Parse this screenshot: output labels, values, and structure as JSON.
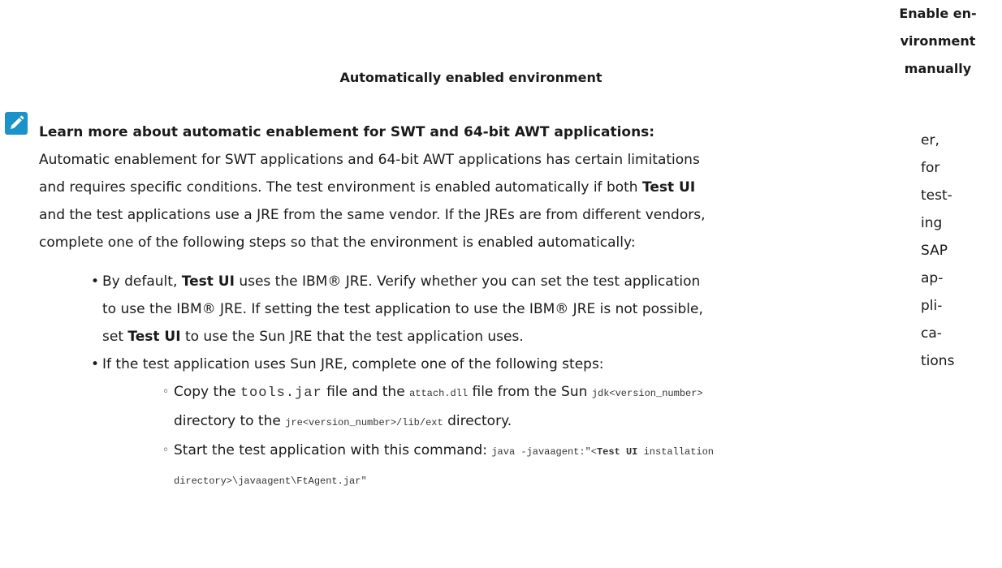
{
  "headers": {
    "left": "Automatically enabled environment",
    "right_lines": [
      "Enable en-",
      "vironment",
      "manually"
    ]
  },
  "note": {
    "icon": "pencil-icon",
    "icon_color": "#1a93c9",
    "title": "Learn more about automatic enablement for SWT and 64-bit AWT applications:",
    "t1": " Automatic enablement for SWT applications and 64-bit AWT applications has certain limitations and requires specific conditions. The test environment is enabled automatically if both ",
    "b1": "Test UI",
    "t2": " and the test applications use a JRE from the same vendor. If the JREs are from different vendors, complete one of the following steps so that the environment is enabled automatically:"
  },
  "bullets": {
    "b1": {
      "t1": "By default, ",
      "b1": "Test UI",
      "t2": " uses the IBM® JRE. Verify whether you can set the test application to use the IBM® JRE. If setting the test application to use the IBM® JRE is not possible, set ",
      "b2": "Test UI",
      "t3": " to use the Sun JRE that the test application uses."
    },
    "b2": {
      "text": "If the test application uses Sun JRE, complete one of the following steps:",
      "s1": {
        "t1": "Copy the ",
        "c1": "tools.jar",
        "t2": " file and the ",
        "c2": "attach.dll",
        "t3": " file from the Sun ",
        "c3": "jdk<version_number>",
        "t4": " directory to the ",
        "c4": "jre<version_number>/lib/ext",
        "t5": " directory."
      },
      "s2": {
        "t1": "Start the test application with this command: ",
        "c1": "java -javaagent:\"<",
        "c2": "Test UI",
        "c3": " installation directory>\\javaagent\\FtAgent.jar\""
      }
    }
  },
  "right_column": [
    "er,",
    "for",
    "test-",
    "ing",
    "SAP",
    "ap-",
    "pli-",
    "ca-",
    "tions"
  ]
}
